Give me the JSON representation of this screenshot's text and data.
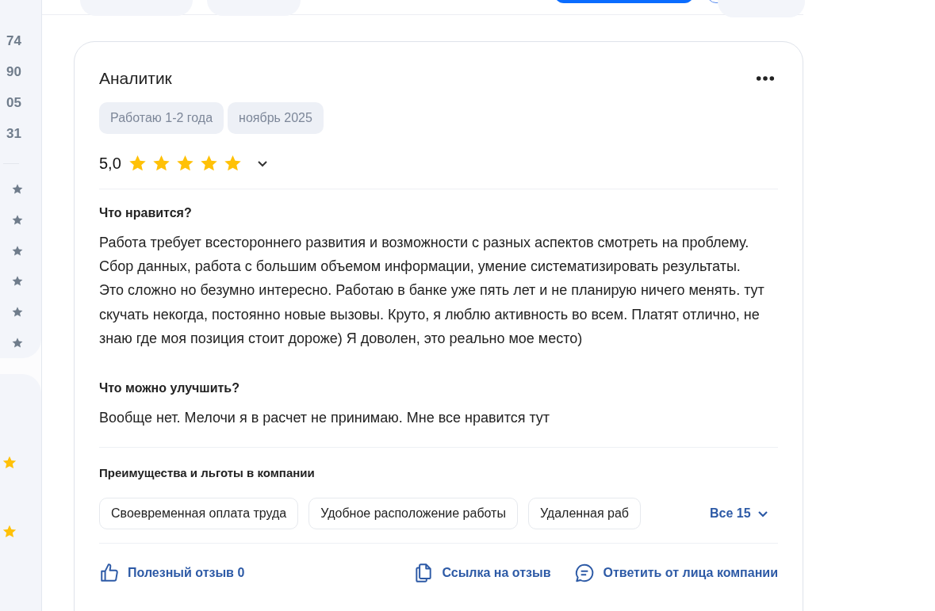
{
  "sidebar": {
    "counts": [
      "74",
      "90",
      "05",
      "31"
    ]
  },
  "review": {
    "title": "Аналитик",
    "tags": [
      "Работаю 1-2 года",
      "ноябрь 2025"
    ],
    "rating": "5,0",
    "stars": 5,
    "sections": [
      {
        "heading": "Что нравится?",
        "text": "Работа требует всестороннего развития и возможности с разных аспектов смотреть на проблему. Сбор данных, работа с большим объемом информации, умение систематизировать результаты. Это сложно но безумно интересно. Работаю в банке уже пять лет и не планирую ничего менять. тут скучать некогда, постоянно новые вызовы. Круто, я люблю активность во всем. Платят отлично, не знаю где моя позиция стоит дороже) Я доволен, это реально мое место)"
      },
      {
        "heading": "Что можно улучшить?",
        "text": "Вообще нет. Мелочи я в расчет не принимаю. Мне все нравится тут"
      }
    ],
    "benefits": {
      "heading": "Преимущества и льготы в компании",
      "items": [
        "Своевременная оплата труда",
        "Удобное расположение работы",
        "Удаленная раб"
      ],
      "more": "Все 15"
    },
    "actions": [
      {
        "kind": "like",
        "label": "Полезный отзыв 0"
      },
      {
        "kind": "link",
        "label": "Ссылка на отзыв"
      },
      {
        "kind": "reply",
        "label": "Ответить от лица компании"
      }
    ]
  }
}
